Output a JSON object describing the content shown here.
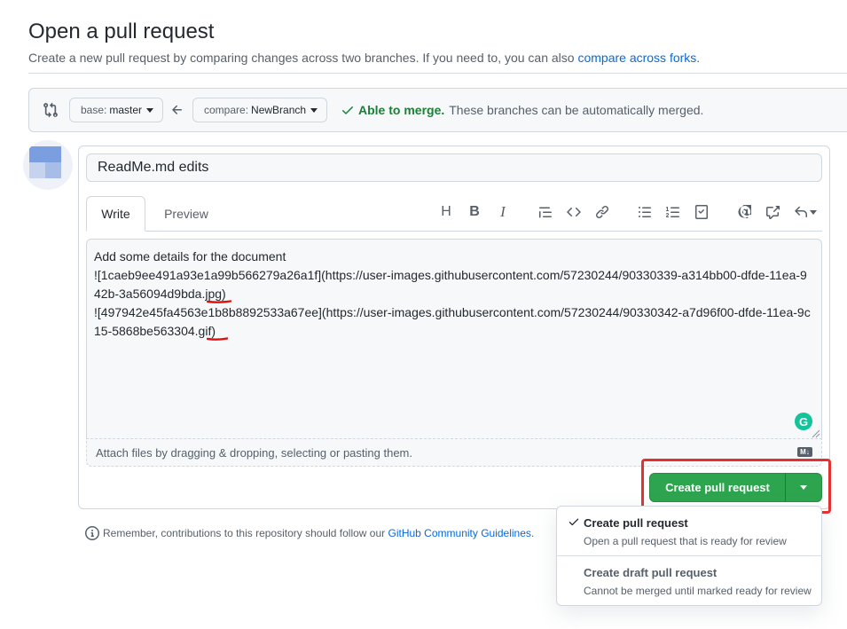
{
  "header": {
    "title": "Open a pull request",
    "subtitle": "Create a new pull request by comparing changes across two branches. If you need to, you can also",
    "subtitle_link": "compare across forks",
    "subtitle_end": "."
  },
  "range": {
    "base_prefix": "base:",
    "base_value": "master",
    "compare_prefix": "compare:",
    "compare_value": "NewBranch",
    "merge_ok": "Able to merge.",
    "merge_text": "These branches can be automatically merged."
  },
  "form": {
    "title_value": "ReadMe.md edits",
    "tabs": [
      "Write",
      "Preview"
    ],
    "body_text": "Add some details for the document\n![1caeb9ee491a93e1a99b566279a26a1f](https://user-images.githubusercontent.com/57230244/90330339-a314bb00-dfde-11ea-942b-3a56094d9bda.jpg)\n![497942e45fa4563e1b8b8892533a67ee](https://user-images.githubusercontent.com/57230244/90330342-a7d96f00-dfde-11ea-9c15-5868be563304.gif)",
    "attach_text": "Attach files by dragging & dropping, selecting or pasting them.",
    "grammarly": "G",
    "markdown_badge": "M↓"
  },
  "toolbar": {
    "heading": "H",
    "bold": "B",
    "italic": "I"
  },
  "submit": {
    "create_label": "Create pull request"
  },
  "guidelines": {
    "text": "Remember, contributions to this repository should follow our",
    "link": "GitHub Community Guidelines",
    "end": "."
  },
  "menu": {
    "items": [
      {
        "title": "Create pull request",
        "desc": "Open a pull request that is ready for review",
        "selected": true
      },
      {
        "title": "Create draft pull request",
        "desc": "Cannot be merged until marked ready for review",
        "selected": false
      }
    ]
  },
  "colors": {
    "primary_green": "#2da44e",
    "link_blue": "#0969da",
    "highlight_red": "#e53030",
    "success_green": "#1a7f37"
  }
}
